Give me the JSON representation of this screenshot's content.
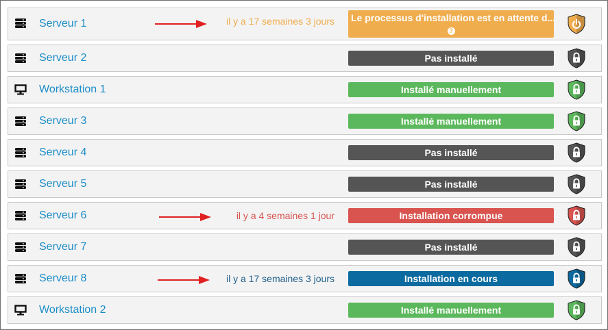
{
  "colors": {
    "link": "#1c8dc8",
    "waiting": "#f0ad4e",
    "not_installed": "#555555",
    "installed": "#5cb85c",
    "corrupt": "#d9534f",
    "in_progress": "#0b6aa0",
    "arrow": "#e02020"
  },
  "rows": [
    {
      "name": "Serveur 1",
      "type": "server",
      "time": "il y a 17 semaines 3 jours",
      "time_color": "#f0ad4e",
      "arrow": true,
      "status": "Le processus d'installation est en attente d...",
      "status_color": "#f0ad4e",
      "help": "?",
      "shield": "power-shield",
      "shield_color": "#f0ad4e"
    },
    {
      "name": "Serveur 2",
      "type": "server",
      "time": "",
      "arrow": false,
      "status": "Pas installé",
      "status_color": "#555555",
      "shield": "lock-shield",
      "shield_color": "#555555"
    },
    {
      "name": "Workstation 1",
      "type": "workstation",
      "time": "",
      "arrow": false,
      "status": "Installé manuellement",
      "status_color": "#5cb85c",
      "shield": "lock-shield",
      "shield_color": "#5cb85c"
    },
    {
      "name": "Serveur 3",
      "type": "server",
      "time": "",
      "arrow": false,
      "status": "Installé manuellement",
      "status_color": "#5cb85c",
      "shield": "lock-shield",
      "shield_color": "#5cb85c"
    },
    {
      "name": "Serveur 4",
      "type": "server",
      "time": "",
      "arrow": false,
      "status": "Pas installé",
      "status_color": "#555555",
      "shield": "lock-shield",
      "shield_color": "#555555"
    },
    {
      "name": "Serveur 5",
      "type": "server",
      "time": "",
      "arrow": false,
      "status": "Pas installé",
      "status_color": "#555555",
      "shield": "lock-shield",
      "shield_color": "#555555"
    },
    {
      "name": "Serveur 6",
      "type": "server",
      "time": "il y a 4 semaines 1 jour",
      "time_color": "#d9534f",
      "arrow": true,
      "status": "Installation corrompue",
      "status_color": "#d9534f",
      "shield": "lock-shield",
      "shield_color": "#d9534f"
    },
    {
      "name": "Serveur 7",
      "type": "server",
      "time": "",
      "arrow": false,
      "status": "Pas installé",
      "status_color": "#555555",
      "shield": "lock-shield",
      "shield_color": "#555555"
    },
    {
      "name": "Serveur 8",
      "type": "server",
      "time": "il y a 17 semaines 3 jours",
      "time_color": "#1f5f8b",
      "arrow": true,
      "status": "Installation en cours",
      "status_color": "#0b6aa0",
      "shield": "lock-shield",
      "shield_color": "#0b6aa0"
    },
    {
      "name": "Workstation 2",
      "type": "workstation",
      "time": "",
      "arrow": false,
      "status": "Installé manuellement",
      "status_color": "#5cb85c",
      "shield": "lock-shield",
      "shield_color": "#5cb85c"
    }
  ]
}
